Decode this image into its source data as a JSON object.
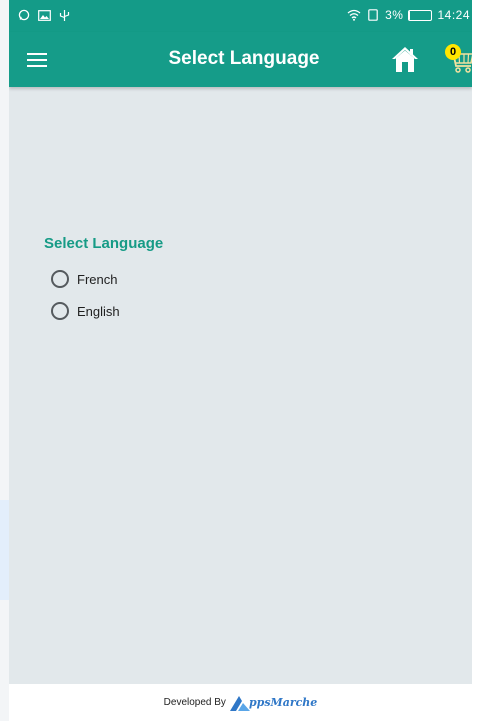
{
  "status_bar": {
    "left_icons": [
      "whatsapp-icon",
      "image-icon",
      "usb-icon"
    ],
    "battery_text": "3%",
    "battery_level": 0.03,
    "time": "14:24"
  },
  "app_bar": {
    "title": "Select Language",
    "cart_count": "0"
  },
  "language": {
    "title": "Select Language",
    "options": [
      "French",
      "English"
    ]
  },
  "footer": {
    "prefix": "Developed By",
    "brand": "ppsMarche"
  },
  "colors": {
    "primary": "#149b88",
    "background": "#e2e8eb",
    "accent_text": "#169b86",
    "badge": "#ffe600",
    "brand": "#2f77c7"
  }
}
